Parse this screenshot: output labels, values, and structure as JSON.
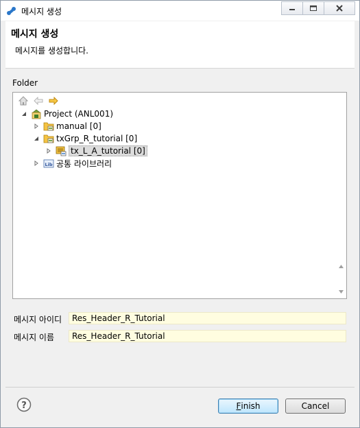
{
  "window": {
    "title": "메시지 생성",
    "controls": [
      "minimize",
      "maximize",
      "close"
    ]
  },
  "banner": {
    "title": "메시지 생성",
    "description": "메시지를 생성합니다."
  },
  "folder": {
    "label": "Folder",
    "toolbar": [
      "home-icon",
      "back-arrow-icon",
      "forward-arrow-icon"
    ],
    "tree": [
      {
        "label": "Project  (ANL001)",
        "icon": "project-icon",
        "expanded": true,
        "level": 0
      },
      {
        "label": "manual [0]",
        "icon": "folder-group-icon",
        "expanded": false,
        "level": 1
      },
      {
        "label": "txGrp_R_tutorial [0]",
        "icon": "folder-group-icon",
        "expanded": true,
        "level": 1
      },
      {
        "label": "tx_L_A_tutorial [0]",
        "icon": "transaction-icon",
        "expanded": false,
        "level": 2,
        "selected": true
      },
      {
        "label": "공통 라이브러리",
        "icon": "library-icon",
        "expanded": false,
        "level": 1
      }
    ]
  },
  "fields": {
    "message_id": {
      "label": "메시지 아이디",
      "value": "Res_Header_R_Tutorial"
    },
    "message_name": {
      "label": "메시지 이름",
      "value": "Res_Header_R_Tutorial"
    }
  },
  "buttons": {
    "finish_mnemonic": "F",
    "finish_rest": "inish",
    "cancel": "Cancel"
  },
  "colors": {
    "field_bg": "#fffde0",
    "default_button": "#bee6fd",
    "folder_yellow": "#f5c342"
  }
}
